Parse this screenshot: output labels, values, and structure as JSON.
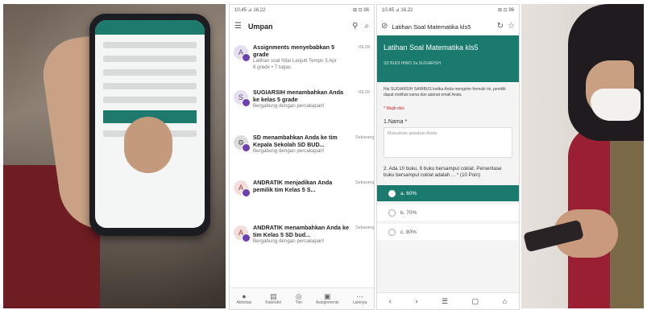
{
  "panel2": {
    "status_left": "10.45 ⊿ 16.22",
    "status_right": "⊞ ⊡ 96",
    "title": "Umpan",
    "feed": [
      {
        "avatar": "A",
        "title": "Assignments menyebabkan 5 grade",
        "sub": "Latihan soal Nilai Lanjutt Tempo 5 Apr",
        "sub2": "6 grade • 7 tugas",
        "time": "09.28"
      },
      {
        "avatar": "S",
        "title": "SUGIARSIH menambahkan Anda ke kelas 5 grade",
        "sub": "Bergabung dengan percakapan!",
        "sub2": "",
        "time": "09.26"
      },
      {
        "avatar": "",
        "title": "SD menambahkan Anda ke tim Kepala Sekolah SD BUD...",
        "sub": "Bergabung dengan percakapan!",
        "sub2": "",
        "time": "Sekarang"
      },
      {
        "avatar": "A",
        "title": "ANDRATIK menjadikan Anda pemilik tim Kelas 5 S...",
        "sub": "",
        "sub2": "",
        "time": "Sekarang"
      },
      {
        "avatar": "A",
        "title": "ANDRATIK menambahkan Anda ke tim Kelas 5 SD bud...",
        "sub": "Bergabung dengan percakapan!",
        "sub2": "",
        "time": "Sekarang"
      }
    ],
    "nav": [
      {
        "icon": "●",
        "label": "Aktivitas"
      },
      {
        "icon": "▤",
        "label": "Kalender"
      },
      {
        "icon": "◎",
        "label": "Tim"
      },
      {
        "icon": "▣",
        "label": "Assignments"
      },
      {
        "icon": "⋯",
        "label": "Lainnya"
      }
    ]
  },
  "panel3": {
    "status_left": "10.45 ⊿ 16.22",
    "status_right": "⊞ ⊡ 96",
    "title": "Latihan Soal Matematika kls5",
    "banner_title": "Latihan Soal Matematika kls5",
    "banner_sub": "SD BUDI HIWO 3a SUGIARSIH",
    "desc": "Hai SUGIARSIH SARIBUS ketika Anda mengirim formulir ini, pemilik dapat melihat nama dan alamat email Anda.",
    "required": "* Wajib diisi",
    "q1": "1.Nama *",
    "q1_placeholder": "Masukkan jawaban Anda",
    "q2": "2. Ada 10 buku, 6 buku bersampul coklat. Persentase buku bersampul coklat adalah ... * (10 Poin)",
    "options": [
      {
        "label": "a. 60%",
        "selected": true
      },
      {
        "label": "b. 70%",
        "selected": false
      },
      {
        "label": "c. 80%",
        "selected": false
      }
    ]
  }
}
